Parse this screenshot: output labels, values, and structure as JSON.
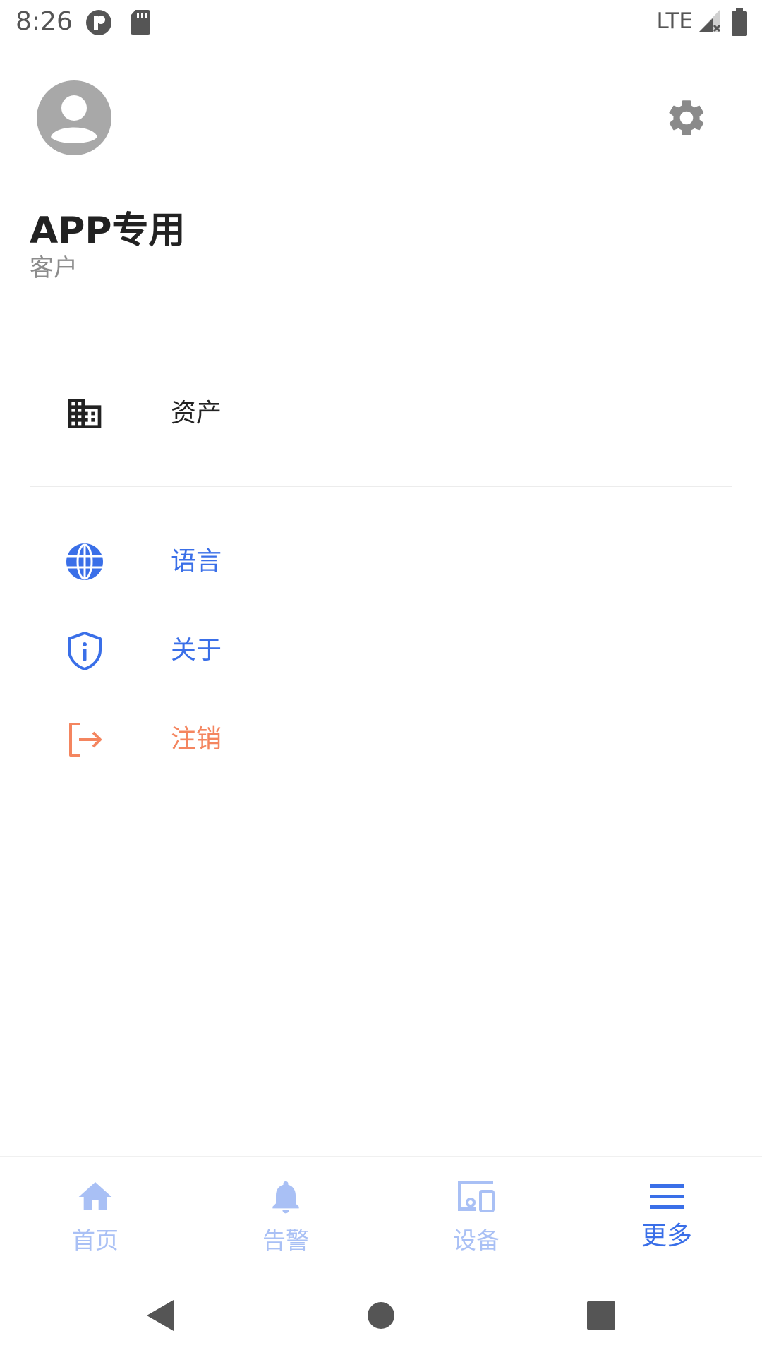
{
  "status_bar": {
    "time": "8:26",
    "network": "LTE"
  },
  "profile": {
    "name": "APP专用",
    "role": "客户",
    "avatar_icon": "account-circle-icon",
    "settings_icon": "gear-icon"
  },
  "menu": {
    "assets": {
      "label": "资产",
      "icon": "building-icon",
      "color": "#222222"
    },
    "language": {
      "label": "语言",
      "icon": "globe-icon",
      "color": "#3a6fe8"
    },
    "about": {
      "label": "关于",
      "icon": "shield-info-icon",
      "color": "#3a6fe8"
    },
    "logout": {
      "label": "注销",
      "icon": "logout-icon",
      "color": "#f4855f"
    }
  },
  "bottom_nav": {
    "items": [
      {
        "label": "首页",
        "icon": "home-icon",
        "active": false
      },
      {
        "label": "告警",
        "icon": "bell-icon",
        "active": false
      },
      {
        "label": "设备",
        "icon": "devices-icon",
        "active": false
      },
      {
        "label": "更多",
        "icon": "menu-icon",
        "active": true
      }
    ],
    "active_color": "#3a6fe8",
    "inactive_color": "#a9c0f5"
  }
}
